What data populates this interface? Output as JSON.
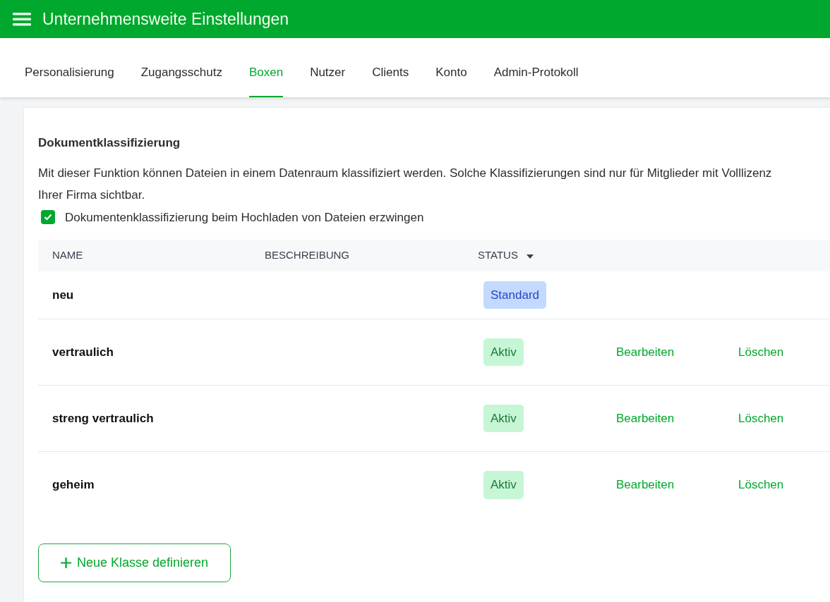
{
  "header": {
    "title": "Unternehmensweite Einstellungen"
  },
  "tabs": [
    {
      "label": "Personalisierung",
      "selected": false
    },
    {
      "label": "Zugangsschutz",
      "selected": false
    },
    {
      "label": "Boxen",
      "selected": true
    },
    {
      "label": "Nutzer",
      "selected": false
    },
    {
      "label": "Clients",
      "selected": false
    },
    {
      "label": "Konto",
      "selected": false
    },
    {
      "label": "Admin-Protokoll",
      "selected": false
    }
  ],
  "section": {
    "title": "Dokumentklassifizierung",
    "description": "Mit dieser Funktion können Dateien in einem Datenraum klassifiziert werden. Solche Klassifizierungen sind nur für Mitglieder mit Volllizenz Ihrer Firma sichtbar.",
    "checkbox": {
      "label": "Dokumentenklassifizierung beim Hochladen von Dateien erzwingen",
      "checked": true
    }
  },
  "table": {
    "columns": [
      {
        "label": "NAME",
        "sorted": false
      },
      {
        "label": "BESCHREIBUNG",
        "sorted": false
      },
      {
        "label": "STATUS",
        "sorted": true
      }
    ],
    "rows": [
      {
        "name": "neu",
        "status": {
          "label": "Standard",
          "kind": "default"
        },
        "actions": []
      },
      {
        "name": "vertraulich",
        "status": {
          "label": "Aktiv",
          "kind": "active"
        },
        "actions": [
          "Bearbeiten",
          "Löschen"
        ]
      },
      {
        "name": "streng vertraulich",
        "status": {
          "label": "Aktiv",
          "kind": "active"
        },
        "actions": [
          "Bearbeiten",
          "Löschen"
        ]
      },
      {
        "name": "geheim",
        "status": {
          "label": "Aktiv",
          "kind": "active"
        },
        "actions": [
          "Bearbeiten",
          "Löschen"
        ]
      }
    ]
  },
  "add_button": {
    "label": "Neue Klasse definieren"
  }
}
